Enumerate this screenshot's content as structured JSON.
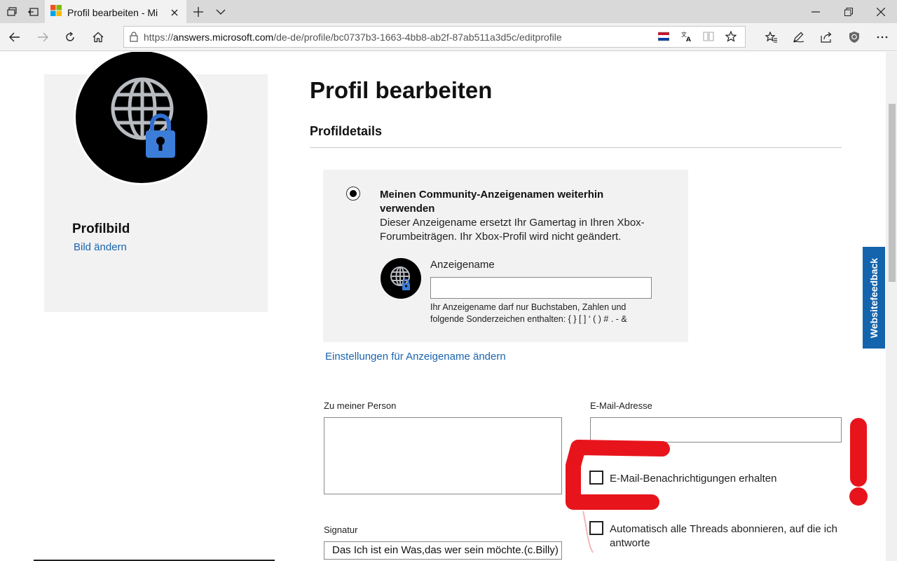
{
  "browser": {
    "tab_title": "Profil bearbeiten - Mi",
    "url_prefix": "https://",
    "url_host": "answers.microsoft.com",
    "url_path": "/de-de/profile/bc0737b3-1663-4bb8-ab2f-87ab511a3d5c/editprofile"
  },
  "profile_card": {
    "title": "Profilbild",
    "change_link": "Bild ändern"
  },
  "main": {
    "page_title": "Profil bearbeiten",
    "section_title": "Profildetails",
    "display_name": {
      "radio_title": "Meinen Community-Anzeigenamen weiterhin verwenden",
      "radio_description": "Dieser Anzeigename ersetzt Ihr Gamertag in Ihren Xbox-Forumbeiträgen. Ihr Xbox-Profil wird nicht geändert.",
      "field_label": "Anzeigename",
      "field_value": "",
      "hint": "Ihr Anzeigename darf nur Buchstaben, Zahlen und folgende Sonderzeichen enthalten: { } [ ] ‘ ( ) # . - &",
      "selected": true
    },
    "settings_link": "Einstellungen für Anzeigename ändern",
    "about": {
      "label": "Zu meiner Person",
      "value": ""
    },
    "email": {
      "label": "E-Mail-Adresse",
      "value": ""
    },
    "email_notifications": {
      "label": "E-Mail-Benachrichtigungen erhalten",
      "checked": false
    },
    "auto_subscribe": {
      "label": "Automatisch alle Threads abonnieren, auf die ich antworte",
      "checked": false
    },
    "signature": {
      "label": "Signatur",
      "value": "Das Ich ist ein Was,das wer sein möchte.(c.Billy)"
    }
  },
  "feedback_tab": {
    "label": "Websitefeedback"
  },
  "colors": {
    "link": "#1a64ad",
    "feedback_bg": "#1464ad",
    "annotation": "#e8141b",
    "lock_blue": "#3b7dd8"
  },
  "icons": [
    "tab-actions-icon",
    "set-aside-icon",
    "ms-logo-icon",
    "close-tab-icon",
    "new-tab-icon",
    "tab-list-icon",
    "minimize-icon",
    "restore-icon",
    "close-window-icon",
    "back-icon",
    "forward-icon",
    "refresh-icon",
    "home-icon",
    "lock-icon",
    "flag-icon",
    "translate-icon",
    "reading-view-icon",
    "favorite-star-icon",
    "favorites-icon",
    "pen-icon",
    "share-icon",
    "extension-icon",
    "more-icon",
    "globe-lock-icon"
  ]
}
